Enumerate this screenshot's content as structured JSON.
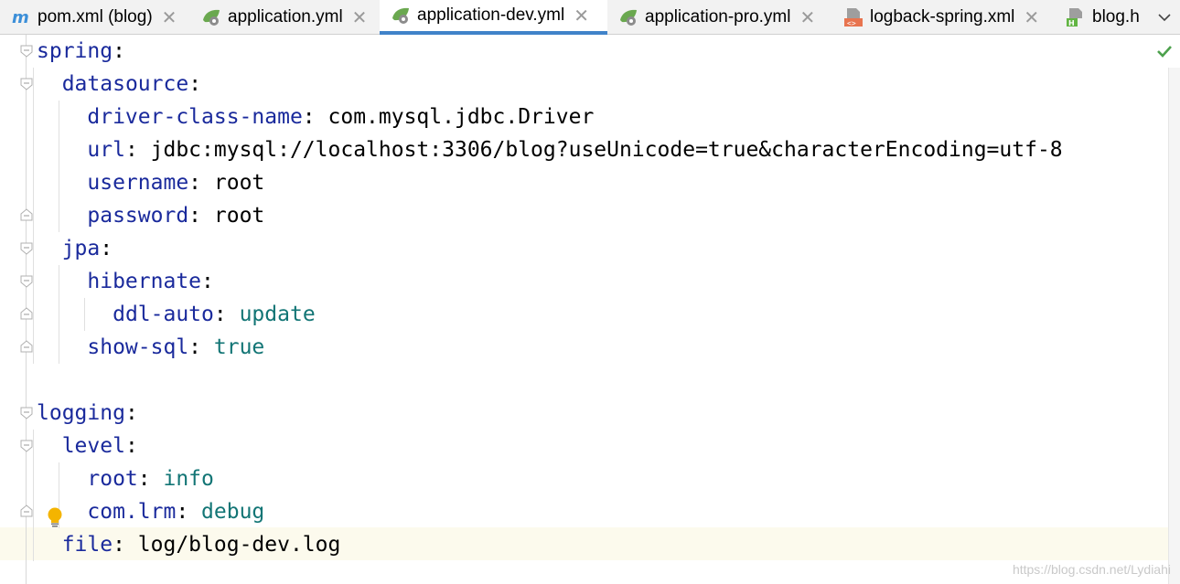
{
  "tabs": [
    {
      "label": "pom.xml (blog)",
      "icon": "maven-icon",
      "active": false
    },
    {
      "label": "application.yml",
      "icon": "spring-config-icon",
      "active": false
    },
    {
      "label": "application-dev.yml",
      "icon": "spring-config-icon",
      "active": true
    },
    {
      "label": "application-pro.yml",
      "icon": "spring-config-icon",
      "active": false
    },
    {
      "label": "logback-spring.xml",
      "icon": "xml-file-icon",
      "active": false
    },
    {
      "label": "blog.h",
      "icon": "html-file-icon",
      "active": false
    }
  ],
  "tab_close_glyph": "✕",
  "colors": {
    "active_tab_underline": "#4083c9",
    "yaml_key": "#1a2a9c",
    "yaml_keyword": "#127575",
    "current_line": "#fcfaed"
  },
  "code": [
    {
      "key": "spring",
      "sep": ":",
      "value": "",
      "value_type": "none",
      "indent": 0
    },
    {
      "key": "datasource",
      "sep": ":",
      "value": "",
      "value_type": "none",
      "indent": 1
    },
    {
      "key": "driver-class-name",
      "sep": ": ",
      "value": "com.mysql.jdbc.Driver",
      "value_type": "plain",
      "indent": 2
    },
    {
      "key": "url",
      "sep": ": ",
      "value": "jdbc:mysql://localhost:3306/blog?useUnicode=true&characterEncoding=utf-8",
      "value_type": "plain",
      "indent": 2
    },
    {
      "key": "username",
      "sep": ": ",
      "value": "root",
      "value_type": "plain",
      "indent": 2
    },
    {
      "key": "password",
      "sep": ": ",
      "value": "root",
      "value_type": "plain",
      "indent": 2
    },
    {
      "key": "jpa",
      "sep": ":",
      "value": "",
      "value_type": "none",
      "indent": 1
    },
    {
      "key": "hibernate",
      "sep": ":",
      "value": "",
      "value_type": "none",
      "indent": 2
    },
    {
      "key": "ddl-auto",
      "sep": ": ",
      "value": "update",
      "value_type": "keyword",
      "indent": 3
    },
    {
      "key": "show-sql",
      "sep": ": ",
      "value": "true",
      "value_type": "keyword",
      "indent": 2
    },
    {
      "key": "",
      "sep": "",
      "value": "",
      "value_type": "none",
      "indent": 0
    },
    {
      "key": "logging",
      "sep": ":",
      "value": "",
      "value_type": "none",
      "indent": 0
    },
    {
      "key": "level",
      "sep": ":",
      "value": "",
      "value_type": "none",
      "indent": 1
    },
    {
      "key": "root",
      "sep": ": ",
      "value": "info",
      "value_type": "keyword",
      "indent": 2
    },
    {
      "key": "com.lrm",
      "sep": ": ",
      "value": "debug",
      "value_type": "keyword",
      "indent": 2
    },
    {
      "key": "file",
      "sep": ": ",
      "value": "log/blog-dev.log",
      "value_type": "plain",
      "indent": 1
    }
  ],
  "inspection_status": "no-problems-check-icon",
  "intention_bulb": "lightbulb-icon",
  "watermark": "https://blog.csdn.net/Lydiahi"
}
